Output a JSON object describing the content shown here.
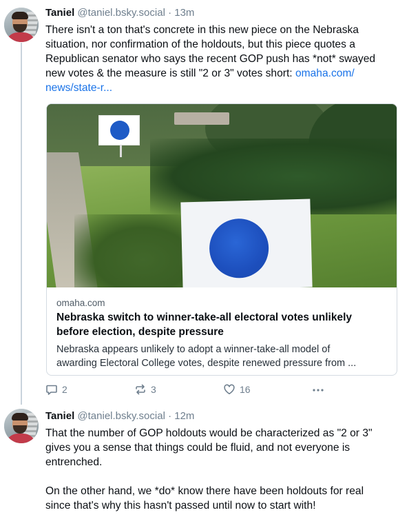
{
  "posts": [
    {
      "author_name": "Taniel",
      "author_handle": "@taniel.bsky.social",
      "separator": "·",
      "time": "13m",
      "text_lines": [
        "There isn't a ton that's concrete in this new piece on the Nebraska",
        "situation, nor confirmation of the holdouts, but this piece quotes a",
        "Republican senator who says the recent GOP push has *not* swayed",
        "new votes & the measure is still \"2 or 3\" votes short: "
      ],
      "link_part1": "omaha.com/",
      "link_part2": "news/state-r...",
      "embed": {
        "domain": "omaha.com",
        "title_line1": "Nebraska switch to winner-take-all electoral votes unlikely",
        "title_line2": "before election, despite pressure",
        "desc_line1": "Nebraska appears unlikely to adopt a winner-take-all model of",
        "desc_line2": "awarding Electoral College votes, despite renewed pressure from ..."
      },
      "counts": {
        "replies": "2",
        "reposts": "3",
        "likes": "16"
      }
    },
    {
      "author_name": "Taniel",
      "author_handle": "@taniel.bsky.social",
      "separator": "·",
      "time": "12m",
      "text_lines": [
        "That the number of GOP holdouts would be characterized as \"2 or 3\"",
        "gives you a sense that things could be fluid, and not everyone is",
        "entrenched.",
        "",
        "On the other hand, we *do* know there have been holdouts for real",
        "since that's why this hasn't passed until now to start with!"
      ]
    }
  ],
  "icons": {
    "reply": "speech-bubble-icon",
    "repost": "repost-arrows-icon",
    "like": "heart-icon",
    "more": "ellipsis-icon"
  },
  "colors": {
    "link": "#1a73e8",
    "muted": "#6f7f8e",
    "thread_line": "#c9d3dc"
  }
}
